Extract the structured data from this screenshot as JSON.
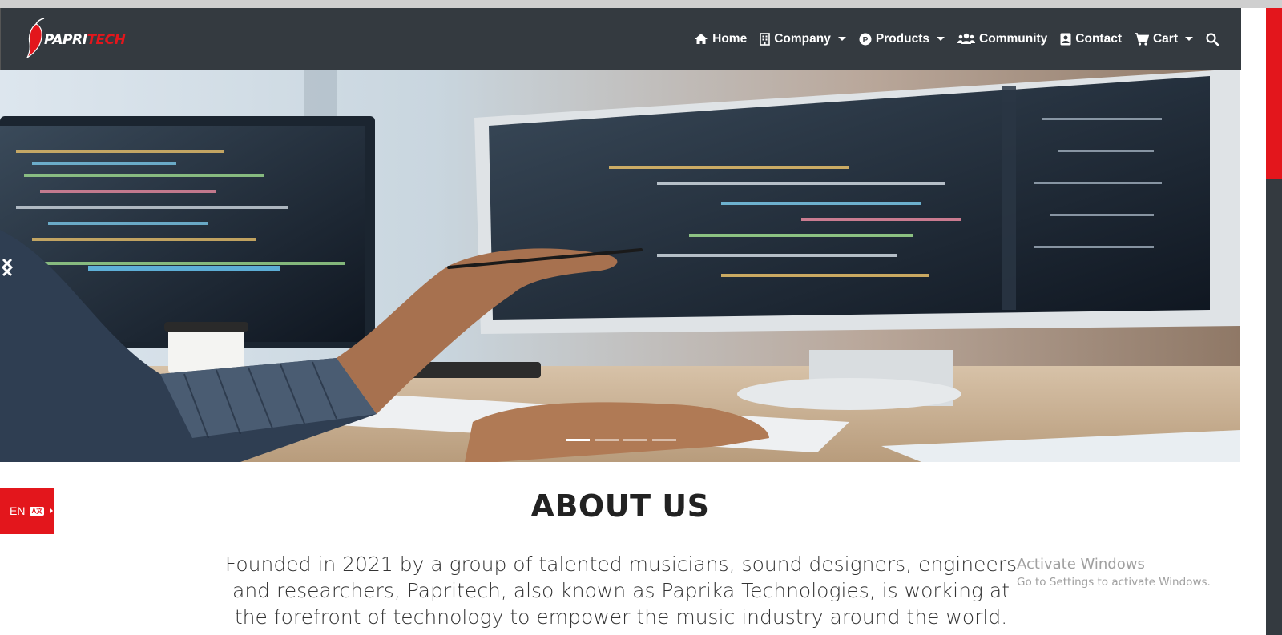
{
  "brand": {
    "logo_text_white": "PAPRI",
    "logo_text_red": "TECH"
  },
  "nav": {
    "items": [
      {
        "label": "Home",
        "icon": "home-icon",
        "dropdown": false
      },
      {
        "label": "Company",
        "icon": "building-icon",
        "dropdown": true
      },
      {
        "label": "Products",
        "icon": "p-circle-icon",
        "dropdown": true
      },
      {
        "label": "Community",
        "icon": "users-icon",
        "dropdown": false
      },
      {
        "label": "Contact",
        "icon": "contact-card-icon",
        "dropdown": false
      },
      {
        "label": "Cart",
        "icon": "cart-icon",
        "dropdown": true
      }
    ],
    "search_icon": "search-icon"
  },
  "carousel": {
    "slide_count": 4,
    "active_index": 0
  },
  "language": {
    "code": "EN",
    "badge": "A文"
  },
  "about": {
    "title": "ABOUT US",
    "text": "Founded in 2021 by a group of talented musicians, sound designers, engineers and researchers, Papritech, also known as Paprika Technologies, is working at the forefront of technology to empower the music industry around the world."
  },
  "watermark": {
    "title": "Activate Windows",
    "subtitle": "Go to Settings to activate Windows."
  },
  "colors": {
    "navbar": "#343a40",
    "accent_red": "#e3161c"
  }
}
